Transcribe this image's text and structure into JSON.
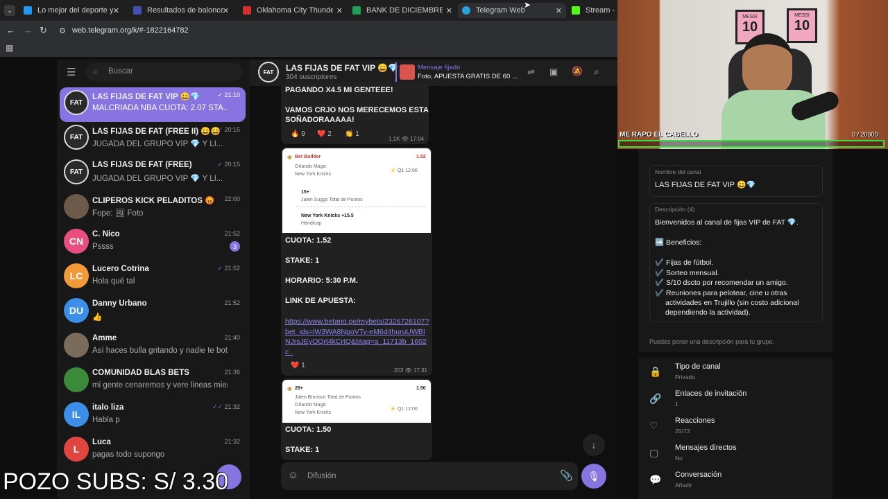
{
  "browser": {
    "tabs": [
      {
        "label": "Lo mejor del deporte y el entr",
        "color": "#2196f3"
      },
      {
        "label": "Resultados de baloncesto en d",
        "color": "#3f51b5"
      },
      {
        "label": "Oklahoma City Thunder - San A",
        "color": "#d32f2f"
      },
      {
        "label": "BANK DE DICIEMBRE",
        "color": "#1e9e58"
      },
      {
        "label": "Telegram Web",
        "color": "#2aa3dc"
      },
      {
        "label": "Stream - Kick",
        "color": "#53fc18"
      }
    ],
    "url": "web.telegram.org/k/#-1822164782"
  },
  "sidebar": {
    "search_placeholder": "Buscar",
    "chats": [
      {
        "name": "LAS FIJAS DE FAT VIP 😀💎",
        "time": "21:10",
        "snippet": "MALCRIADA NBA CUOTA: 2.07 STA...",
        "avatar": "FAT",
        "avcolor": "#2a2a2a",
        "active": true
      },
      {
        "name": "LAS FIJAS DE FAT (FREE II) 😀😀",
        "time": "20:15",
        "snippet": "JUGADA DEL GRUPO VIP 💎 Y LI...",
        "avatar": "FAT",
        "avcolor": "#2a2a2a"
      },
      {
        "name": "LAS FIJAS DE FAT (FREE)",
        "time": "20:15",
        "snippet": "JUGADA DEL GRUPO VIP 💎 Y LI...",
        "avatar": "FAT",
        "avcolor": "#2a2a2a"
      },
      {
        "name": "CLIPEROS KICK PELADITOS 😡",
        "time": "22:00",
        "snippet": "Fope: 🖼 Foto",
        "avatar": "",
        "avcolor": "#6d5a4b"
      },
      {
        "name": "C. Nico",
        "time": "21:52",
        "snippet": "Pssss",
        "avatar": "CN",
        "avcolor": "#e84f7e",
        "badge": "3"
      },
      {
        "name": "Lucero Cotrina",
        "time": "21:52",
        "snippet": "Hola qué tal",
        "avatar": "LC",
        "avcolor": "#f29a3a"
      },
      {
        "name": "Danny Urbano",
        "time": "21:52",
        "snippet": "👍",
        "avatar": "DU",
        "avcolor": "#3d8ee8"
      },
      {
        "name": "Amme",
        "time": "21:40",
        "snippet": "Así haces bulla gritando y nadie te bota",
        "avatar": "",
        "avcolor": "#7a6c5a"
      },
      {
        "name": "COMUNIDAD BLAS BETS",
        "time": "21:36",
        "snippet": "mi gente cenaremos y vere lineas mient...",
        "avatar": "",
        "avcolor": "#3a8a3a"
      },
      {
        "name": "italo liza",
        "time": "21:32",
        "snippet": "Habla p",
        "avatar": "IL",
        "avcolor": "#3d8ee8"
      },
      {
        "name": "Luca",
        "time": "21:32",
        "snippet": "pagas todo supongo",
        "avatar": "L",
        "avcolor": "#e0463f"
      }
    ]
  },
  "chat": {
    "title": "LAS FIJAS DE FAT VIP 😀💎",
    "subtitle": "304 suscriptores",
    "pinned_label": "Mensaje fijado",
    "pinned_text": "Foto, APUESTA GRATIS DE 60 ...",
    "msg1_line1": "PAGANDO X4.5 MI GENTEEE!",
    "msg1_line2": "VAMOS CRJO NOS MERECEMOS ESTA",
    "msg1_line3": "SOÑADORAAAAA!",
    "msg1_reactions": [
      "🔥 9",
      "❤️ 2",
      "👏 1"
    ],
    "msg1_views": "1.1K",
    "msg1_time": "17:04",
    "card1": {
      "header": "Bet Builder",
      "odds": "1.52",
      "team1": "Orlando Magic",
      "team2": "New York Knicks",
      "clock": "Q1 12:00",
      "sel1": "15+",
      "sel1_sub": "Jalen Suggs Total de Puntos",
      "sel2": "New York Knicks +15.5",
      "sel2_sub": "Hándicap"
    },
    "msg2_cuota": "CUOTA: 1.52",
    "msg2_stake": "STAKE: 1",
    "msg2_horario": "HORARIO: 5:30 P.M.",
    "msg2_link_label": "LINK DE APUESTA:",
    "msg2_link": "https://www.betano.pe/mybets/2326726107?bet_ids=iW3WA8NpoVTy-eM6d4huruUWBINJrsJEyOQrt4kCrtQ&btag=a_11713b_1602c_",
    "msg2_reaction": "❤️ 1",
    "msg2_views": "203",
    "msg2_time": "17:31",
    "card2": {
      "sel": "28+",
      "odds": "1.50",
      "sub": "Jalen Brunson Total de Puntos",
      "team1": "Orlando Magic",
      "team2": "New York Knicks",
      "clock": "Q1 12:00"
    },
    "msg3_cuota": "CUOTA: 1.50",
    "msg3_stake": "STAKE: 1",
    "composer_placeholder": "Difusión"
  },
  "info": {
    "name_label": "Nombre del canal",
    "name_value": "LAS FIJAS DE FAT VIP 😀💎",
    "desc_label": "Descripción (4)",
    "desc_lines": [
      "Bienvenidos al canal de fijas VIP de FAT 💎.",
      "➡️ Beneficios:",
      "✔️ Fijas de fútbol.",
      "✔️ Sorteo mensual.",
      "✔️ S/10 dscto por recomendar un amigo.",
      "✔️ Reuniones para pelotear, cine u otras",
      "actividades en Trujillo (sin costo adicional",
      "dependiendo la actividad)."
    ],
    "hint": "Puedes poner una descripción para tu grupo.",
    "settings": [
      {
        "label": "Tipo de canal",
        "value": "Privado",
        "icon": "lock-icon"
      },
      {
        "label": "Enlaces de invitación",
        "value": "1",
        "icon": "link-icon"
      },
      {
        "label": "Reacciones",
        "value": "25/73",
        "icon": "heart-icon"
      },
      {
        "label": "Mensajes directos",
        "value": "No",
        "icon": "message-icon"
      },
      {
        "label": "Conversación",
        "value": "Añadir",
        "icon": "chat-icon"
      }
    ]
  },
  "stream": {
    "goal_label": "ME RAPO EL CABELLO",
    "goal_progress": "0 / 20000",
    "goal_fraction": 0,
    "jersey1": "MESSI",
    "jersey2": "MESSI",
    "jersey_number": "10",
    "overlay": "POZO SUBS: S/ 3.30"
  }
}
